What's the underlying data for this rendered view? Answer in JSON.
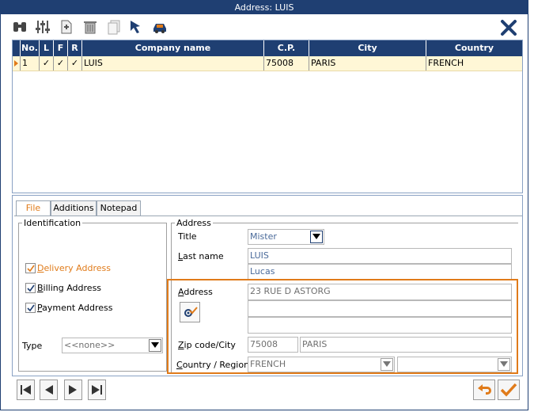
{
  "window": {
    "title": "Address: LUIS"
  },
  "toolbar": {
    "icons": [
      "binoculars-icon",
      "sliders-icon",
      "add-document-icon",
      "trash-icon",
      "copy-icon",
      "pointer-icon",
      "car-icon",
      "close-icon"
    ]
  },
  "grid": {
    "columns": [
      "No.",
      "L",
      "F",
      "R",
      "Company name",
      "C.P.",
      "City",
      "Country"
    ],
    "rows": [
      {
        "no": "1",
        "l": "✓",
        "f": "✓",
        "r": "✓",
        "company": "LUIS",
        "cp": "75008",
        "city": "PARIS",
        "country": "FRENCH"
      }
    ]
  },
  "tabs": [
    "File",
    "Additions",
    "Notepad"
  ],
  "identification": {
    "legend": "Identification",
    "delivery": "Delivery Address",
    "billing": "Billing Address",
    "payment": "Payment Address",
    "type_label": "Type",
    "type_value": "<<none>>"
  },
  "address": {
    "legend": "Address",
    "title_label": "Title",
    "title_value": "Mister",
    "lastname_label": "Last name",
    "lastname_value": "LUIS",
    "firstname_value": "Lucas",
    "address_label": "Address",
    "address_line1": "23 RUE D ASTORG",
    "address_line2": "",
    "address_line3": "",
    "zip_label": "Zip code/City",
    "zip_value": "75008",
    "city_value": "PARIS",
    "country_label": "Country / Region",
    "country_value": "FRENCH",
    "region_value": ""
  },
  "colors": {
    "accent": "#e07b1a",
    "header": "#1f3f72"
  }
}
